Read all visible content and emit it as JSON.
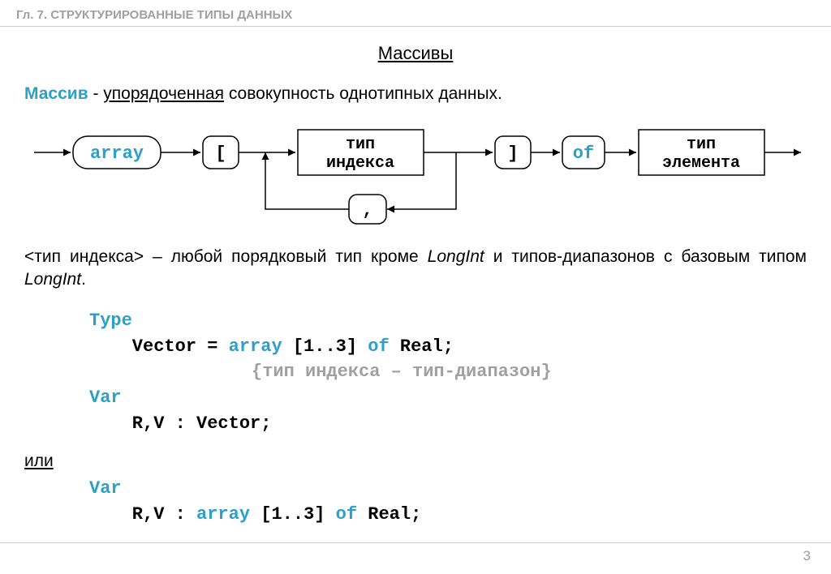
{
  "chapter": "Гл. 7. СТРУКТУРИРОВАННЫЕ ТИПЫ ДАННЫХ",
  "title": "Массивы",
  "definition": {
    "term": "Массив",
    "dash": " - ",
    "underlined": "упорядоченная",
    "rest": " совокупность однотипных данных."
  },
  "diagram": {
    "array": "array",
    "lbracket": "[",
    "index_type_l1": "тип",
    "index_type_l2": "индекса",
    "rbracket": "]",
    "of": "of",
    "elem_type_l1": "тип",
    "elem_type_l2": "элемента",
    "comma": ","
  },
  "para": {
    "p1": "<тип индекса> – любой порядковый тип кроме ",
    "p2": "LongInt",
    "p3": " и типов-диапазонов с базовым типом ",
    "p4": "LongInt",
    "p5": "."
  },
  "code1": {
    "l1_kw": "Type",
    "l2a": "    Vector = ",
    "l2b": "array",
    "l2c": " [1..3] ",
    "l2d": "of",
    "l2e": " Real;",
    "l3_comment": "{тип индекса – тип-диапазон}",
    "l4_kw": "Var",
    "l5": "    R,V : Vector;"
  },
  "or_label": "или",
  "code2": {
    "l1_kw": "Var",
    "l2a": "    R,V : ",
    "l2b": "array",
    "l2c": " [1..3] ",
    "l2d": "of",
    "l2e": " Real;"
  },
  "page": "3"
}
